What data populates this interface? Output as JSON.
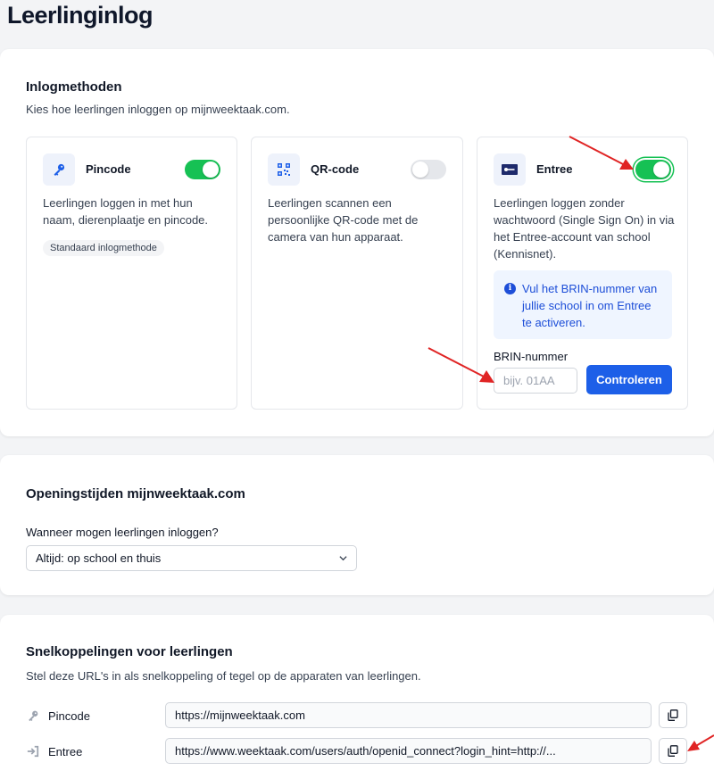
{
  "page": {
    "title": "Leerlinginlog"
  },
  "login_methods": {
    "title": "Inlogmethoden",
    "subtitle": "Kies hoe leerlingen inloggen op mijnweektaak.com.",
    "pincode": {
      "title": "Pincode",
      "icon": "key-icon",
      "enabled": true,
      "description": "Leerlingen loggen in met hun naam, dierenplaatje en pincode.",
      "badge": "Standaard inlogmethode"
    },
    "qr": {
      "title": "QR-code",
      "icon": "qr-code-icon",
      "enabled": false,
      "description": "Leerlingen scannen een persoonlijke QR-code met de camera van hun apparaat."
    },
    "entree": {
      "title": "Entree",
      "icon": "entree-logo-icon",
      "enabled": true,
      "description": "Leerlingen loggen zonder wachtwoord (Single Sign On) in via het Entree-account van school (Kennisnet).",
      "info": "Vul het BRIN-nummer van jullie school in om Entree te activeren.",
      "brin_label": "BRIN-nummer",
      "brin_placeholder": "bijv. 01AA",
      "brin_value": "",
      "check_button": "Controleren"
    }
  },
  "opening_hours": {
    "title": "Openingstijden mijnweektaak.com",
    "question": "Wanneer mogen leerlingen inloggen?",
    "selected": "Altijd: op school en thuis"
  },
  "shortcuts": {
    "title": "Snelkoppelingen voor leerlingen",
    "subtitle": "Stel deze URL's in als snelkoppeling of tegel op de apparaten van leerlingen.",
    "rows": [
      {
        "label": "Pincode",
        "icon": "key-icon",
        "url": "https://mijnweektaak.com"
      },
      {
        "label": "Entree",
        "icon": "sign-in-icon",
        "url": "https://www.weektaak.com/users/auth/openid_connect?login_hint=http://..."
      }
    ]
  },
  "colors": {
    "accent": "#1d5fe8",
    "toggle_on": "#16c154",
    "annotation_arrow": "#e02424"
  }
}
